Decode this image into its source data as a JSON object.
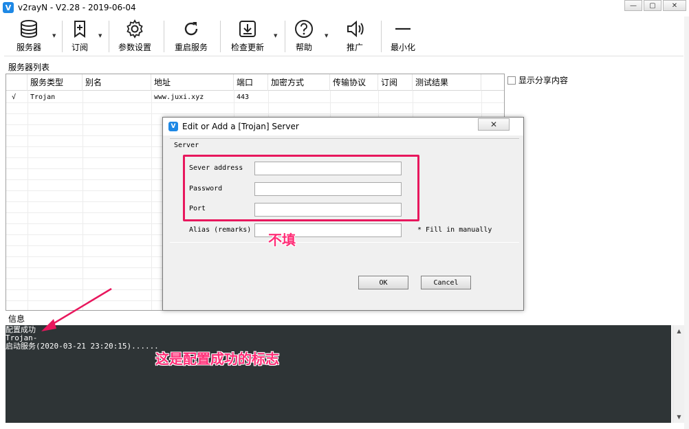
{
  "window": {
    "title": "v2rayN - V2.28 - 2019-06-04",
    "icon_glyph": "V",
    "min_glyph": "—",
    "max_glyph": "▢",
    "close_glyph": "✕"
  },
  "toolbar": {
    "items": [
      {
        "label": "服务器",
        "icon": "database-icon"
      },
      {
        "label": "订阅",
        "icon": "bookmark-icon"
      },
      {
        "label": "参数设置",
        "icon": "gear-icon"
      },
      {
        "label": "重启服务",
        "icon": "refresh-icon"
      },
      {
        "label": "检查更新",
        "icon": "download-icon"
      },
      {
        "label": "帮助",
        "icon": "help-icon"
      },
      {
        "label": "推广",
        "icon": "speaker-icon"
      },
      {
        "label": "最小化",
        "icon": "minimize-icon"
      }
    ],
    "dropdown_glyph": "▼"
  },
  "server_list": {
    "group_label": "服务器列表",
    "columns": [
      "",
      "服务类型",
      "别名",
      "地址",
      "端口",
      "加密方式",
      "传输协议",
      "订阅",
      "测试结果"
    ],
    "rows": [
      [
        "√",
        "Trojan",
        "",
        "www.juxi.xyz",
        "443",
        "",
        "",
        "",
        ""
      ]
    ]
  },
  "share_checkbox": {
    "label": "显示分享内容"
  },
  "info": {
    "label": "信息",
    "lines": [
      "配置成功",
      "Trojan-",
      "启动服务(2020-03-21 23:20:15)......"
    ]
  },
  "dialog": {
    "title": "Edit or Add a [Trojan] Server",
    "icon_glyph": "V",
    "close_glyph": "✕",
    "group": "Server",
    "fields": [
      {
        "label": "Sever address",
        "value": ""
      },
      {
        "label": "Password",
        "value": ""
      },
      {
        "label": "Port",
        "value": ""
      },
      {
        "label": "Alias (remarks)",
        "value": ""
      }
    ],
    "note": "* Fill in manually",
    "ok_label": "OK",
    "cancel_label": "Cancel"
  },
  "annotations": {
    "no_fill": "不填",
    "success_mark": "这是配置成功的标志",
    "color": "#e8175d"
  },
  "scroll": {
    "up": "▲",
    "down": "▼"
  }
}
